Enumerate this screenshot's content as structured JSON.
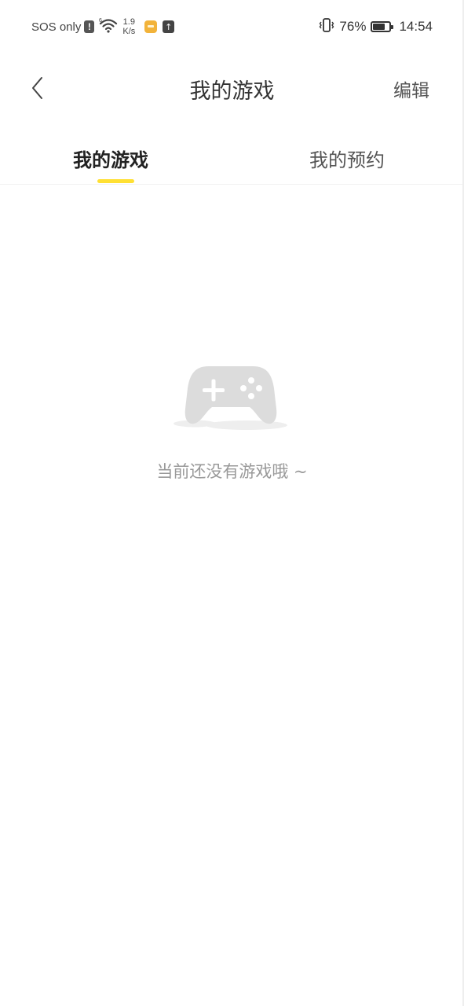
{
  "status_bar": {
    "carrier": "SOS only",
    "alert_glyph": "!",
    "network_speed_value": "1.9",
    "network_speed_unit": "K/s",
    "battery_percent": "76%",
    "battery_level": 0.76,
    "time": "14:54",
    "icons": [
      "alert-icon",
      "wifi-icon",
      "app-notification-icon",
      "upload-icon",
      "vibrate-icon",
      "battery-icon"
    ]
  },
  "header": {
    "title": "我的游戏",
    "back_icon": "chevron-left-icon",
    "edit_label": "编辑"
  },
  "tabs": [
    {
      "label": "我的游戏",
      "active": true
    },
    {
      "label": "我的预约",
      "active": false
    }
  ],
  "empty_state": {
    "icon": "gamepad-icon",
    "message": "当前还没有游戏哦 ~"
  },
  "colors": {
    "accent": "#ffe033",
    "text_primary": "#333333",
    "text_muted": "#999999",
    "icon_placeholder": "#dcdcdc"
  }
}
